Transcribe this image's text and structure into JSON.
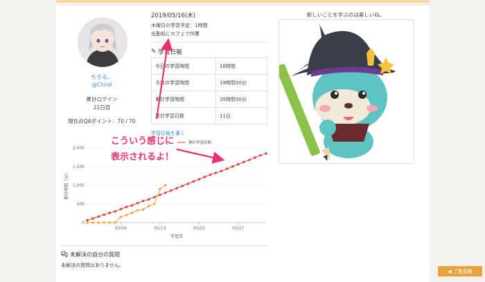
{
  "profile": {
    "name": "ちろる。",
    "handle": "@Chirol",
    "login_label": "累計ログイン",
    "login_days": "21日目",
    "qa_points": "現在のQAポイント：70 / 70"
  },
  "daily": {
    "date": "2019/05/16(木)",
    "plan": "木曜日の学習予定：1時間",
    "note": "出勤前にカフェで作業"
  },
  "report": {
    "title": "学習日報",
    "rows": [
      {
        "label": "今日の学習時間",
        "value": "16時間"
      },
      {
        "label": "今月の学習時間",
        "value": "19時間30分"
      },
      {
        "label": "累計学習時間",
        "value": "35時間30分"
      },
      {
        "label": "累計学習日数",
        "value": "11日"
      }
    ],
    "write_link": "学習日報を書く"
  },
  "chart_data": {
    "type": "line",
    "title": "",
    "xlabel": "学習日",
    "ylabel": "累計時間（分）",
    "ylim": [
      0,
      2000
    ],
    "yticks": [
      "0",
      "500",
      "1,000",
      "1,500",
      "2,000"
    ],
    "xtick_labels": [
      "05/06",
      "05/13",
      "05/20",
      "05/27"
    ],
    "xtick_index": [
      6,
      13,
      20,
      27
    ],
    "legend_partial": "累計学習時間",
    "series": [
      {
        "color": "#e53935",
        "values": [
          60,
          110,
          160,
          210,
          260,
          300,
          360,
          420,
          460,
          520,
          580,
          620,
          680,
          740,
          800,
          860,
          920,
          980,
          1040,
          1100,
          1160,
          1220,
          1280,
          1330,
          1380,
          1440,
          1500,
          1560,
          1620,
          1680,
          1740,
          1800,
          1850
        ]
      },
      {
        "color": "#f2a33a",
        "values": [
          0,
          0,
          0,
          0,
          0,
          0,
          150,
          200,
          260,
          330,
          350,
          440,
          500,
          900,
          1000,
          null,
          null,
          null,
          null,
          null,
          null,
          null,
          null,
          null,
          null,
          null,
          null,
          null,
          null,
          null,
          null,
          null,
          null
        ]
      }
    ]
  },
  "questions": {
    "title": "未解決の自分の質問",
    "empty": "未解決の質問はありません。"
  },
  "motto": "新しいことを学ぶのは楽しいね。",
  "callout": {
    "line1": "こういう感じに",
    "line2": "表示されるよ！"
  },
  "feedback": "ご意見箱"
}
